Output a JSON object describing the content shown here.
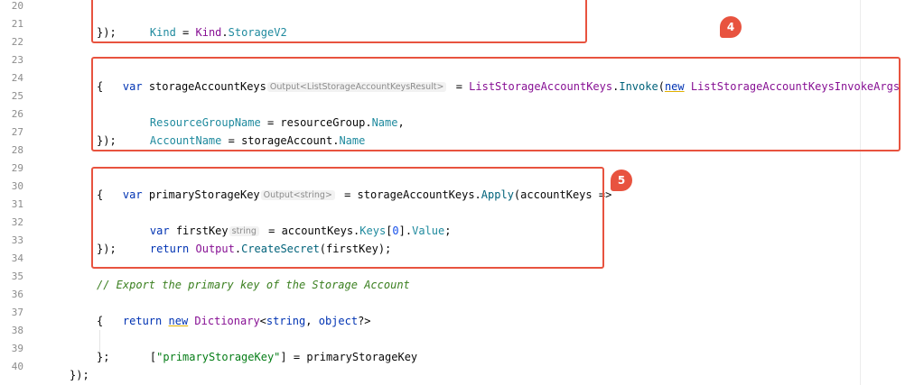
{
  "line_numbers": [
    "20",
    "21",
    "22",
    "23",
    "24",
    "25",
    "26",
    "27",
    "28",
    "29",
    "30",
    "31",
    "32",
    "33",
    "34",
    "35",
    "36",
    "37",
    "38",
    "39",
    "40"
  ],
  "code": {
    "l20": {
      "name": "Kind",
      "op": " = ",
      "ns": "Kind",
      "dot": ".",
      "member": "StorageV2"
    },
    "l21": "});",
    "l23": {
      "kw_var": "var",
      "ident": " storageAccountKeys",
      "hint": "Output<ListStorageAccountKeysResult>",
      "op": " = ",
      "fn_ident": "ListStorageAccountKeys",
      "dot": ".",
      "fn": "Invoke",
      "paren": "(",
      "kw_new": "new",
      "space": " ",
      "type": "ListStorageAccountKeysInvokeArgs"
    },
    "l24": "{",
    "l25": {
      "prop": "ResourceGroupName",
      "op": " = resourceGroup.",
      "member": "Name",
      "end": ","
    },
    "l26": {
      "prop": "AccountName",
      "op": " = storageAccount.",
      "member": "Name"
    },
    "l27": "});",
    "l29": {
      "kw_var": "var",
      "ident": " primaryStorageKey",
      "hint": "Output<string>",
      "op": " = storageAccountKeys.",
      "fn": "Apply",
      "rest": "(accountKeys =>"
    },
    "l30": "{",
    "l31": {
      "kw_var": "var",
      "ident": " firstKey",
      "hint": "string",
      "op": " = accountKeys.",
      "member": "Keys",
      "bracket_open": "[",
      "index": "0",
      "bracket_close": "].",
      "member2": "Value",
      "end": ";"
    },
    "l32": {
      "kw_return": "return",
      "space": " ",
      "type": "Output",
      "dot": ".",
      "fn": "CreateSecret",
      "rest": "(firstKey);"
    },
    "l33": "});",
    "l35": "// Export the primary key of the Storage Account",
    "l36": {
      "kw_return": "return",
      "space": " ",
      "kw_new": "new",
      "space2": " ",
      "type": "Dictionary",
      "lt": "<",
      "kw_string": "string",
      "comma": ", ",
      "kw_object": "object",
      "gt": "?>"
    },
    "l37": "{",
    "l38": {
      "bracket_open": "[",
      "str": "\"primaryStorageKey\"",
      "rest": "] = primaryStorageKey"
    },
    "l39": "};",
    "l40": "});"
  },
  "badges": {
    "b4": "4",
    "b5": "5"
  },
  "colors": {
    "highlight": "#e8533f",
    "keyword": "#0033b3",
    "type": "#871094",
    "property": "#1f8a9e",
    "function": "#00627a",
    "string": "#067d17",
    "comment": "#3a7f1f"
  }
}
